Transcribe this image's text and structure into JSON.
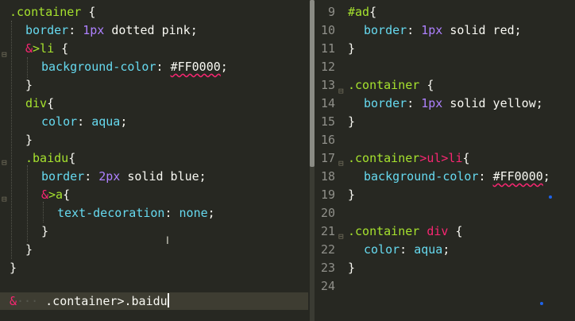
{
  "left_editor": {
    "l1": {
      "sel": ".container",
      "rest": " {"
    },
    "l2": {
      "prop": "border",
      "colon": ": ",
      "num": "1px",
      "val": " dotted pink;"
    },
    "l3": {
      "amp": "&",
      "sel": ">li",
      "rest": " {"
    },
    "l4": {
      "prop": "background-color",
      "colon": ": ",
      "val": "#FF0000",
      "end": ";"
    },
    "l5": {
      "text": "}"
    },
    "l6": {
      "sel": "div",
      "rest": "{"
    },
    "l7": {
      "prop": "color",
      "colon": ": ",
      "val": "aqua",
      "end": ";"
    },
    "l8": {
      "text": "}"
    },
    "l9": {
      "sel": ".baidu",
      "rest": "{"
    },
    "l10": {
      "prop": "border",
      "colon": ": ",
      "num": "2px",
      "val": " solid blue;"
    },
    "l11": {
      "amp": "&",
      "sel": ">a",
      "rest": "{"
    },
    "l12": {
      "prop": "text-decoration",
      "colon": ": ",
      "val": "none",
      "end": ";"
    },
    "l13": {
      "text": "}"
    },
    "l14": {
      "text": "}"
    },
    "l15": {
      "text": "}"
    }
  },
  "command_bar": {
    "amp": "&",
    "text": ".container>.baidu"
  },
  "right_editor": {
    "n9": "9",
    "n10": "10",
    "n11": "11",
    "n12": "12",
    "n13": "13",
    "n14": "14",
    "n15": "15",
    "n16": "16",
    "n17": "17",
    "n18": "18",
    "n19": "19",
    "n20": "20",
    "n21": "21",
    "n22": "22",
    "n23": "23",
    "n24": "24",
    "l9": {
      "sel": "#ad",
      "rest": "{"
    },
    "l10": {
      "prop": "border",
      "colon": ": ",
      "num": "1px",
      "val": " solid red;"
    },
    "l11": {
      "text": "}"
    },
    "l13": {
      "sel": ".container",
      "rest": " {"
    },
    "l14": {
      "prop": "border",
      "colon": ": ",
      "num": "1px",
      "val": " solid yellow;"
    },
    "l15": {
      "text": "}"
    },
    "l17": {
      "sel1": ".container",
      "sel2": ">ul>li",
      "rest": "{"
    },
    "l18": {
      "prop": "background-color",
      "colon": ": ",
      "val": "#FF0000",
      "end": ";"
    },
    "l19": {
      "text": "}"
    },
    "l21": {
      "sel1": ".container",
      "sel2": " div",
      "rest": " {"
    },
    "l22": {
      "prop": "color",
      "colon": ": ",
      "val": "aqua",
      "end": ";"
    },
    "l23": {
      "text": "}"
    }
  },
  "colors": {
    "background": "#272822",
    "selector": "#a6e22e",
    "property": "#66d9ef",
    "number": "#ae81ff",
    "accent": "#f92672"
  },
  "icons": [
    "fold-arrow-icon",
    "text-cursor-icon"
  ]
}
